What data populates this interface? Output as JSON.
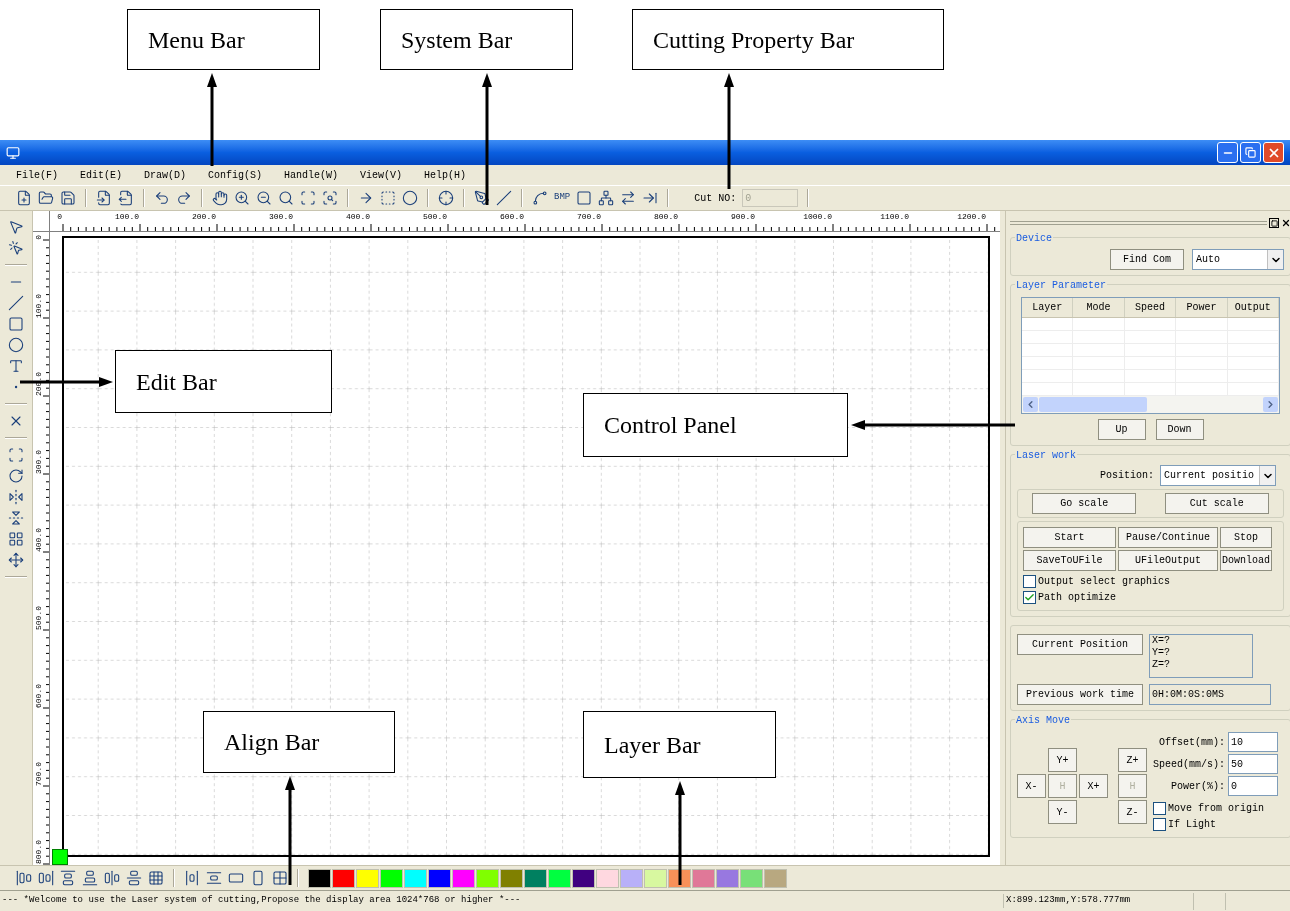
{
  "callouts": [
    {
      "label": "Menu Bar"
    },
    {
      "label": "System Bar"
    },
    {
      "label": "Cutting Property Bar"
    },
    {
      "label": "Edit Bar"
    },
    {
      "label": "Control Panel"
    },
    {
      "label": "Align Bar"
    },
    {
      "label": "Layer Bar"
    }
  ],
  "menu": [
    "File(F)",
    "Edit(E)",
    "Draw(D)",
    "Config(S)",
    "Handle(W)",
    "View(V)",
    "Help(H)"
  ],
  "toolbar": {
    "bmp_label": "BMP",
    "cut_no": {
      "label": "Cut NO:",
      "value": "0",
      "disabled": true
    }
  },
  "top_ruler": [
    "0",
    "100.0",
    "200.0",
    "300.0",
    "400.0",
    "500.0",
    "600.0",
    "700.0",
    "800.0",
    "900.0",
    "1000.0",
    "1100.0",
    "1200.0"
  ],
  "left_ruler": [
    "0",
    "100.0",
    "200.0",
    "300.0",
    "400.0",
    "500.0",
    "600.0",
    "700.0",
    "800.0"
  ],
  "panel": {
    "device": {
      "title": "Device",
      "find_button": "Find Com",
      "port": "Auto"
    },
    "layer_parameter": {
      "title": "Layer Parameter",
      "columns": [
        "Layer",
        "Mode",
        "Speed",
        "Power",
        "Output"
      ],
      "buttons": [
        "Up",
        "Down"
      ]
    },
    "laser_work": {
      "title": "Laser work",
      "position_label": "Position:",
      "position_value": "Current positio",
      "scale_buttons": [
        "Go scale",
        "Cut scale"
      ],
      "buttons": [
        "Start",
        "Pause/Continue",
        "Stop",
        "SaveToUFile",
        "UFileOutput",
        "Download"
      ],
      "options": [
        {
          "label": "Output select graphics",
          "checked": false
        },
        {
          "label": "Path optimize",
          "checked": true
        }
      ]
    },
    "position": {
      "current_button": "Current Position",
      "current_value": [
        "X=?",
        "Y=?",
        "Z=?"
      ],
      "time_button": "Previous work time",
      "time_value": "0H:0M:0S:0MS"
    },
    "axis_move": {
      "title": "Axis Move",
      "xy_pad": [
        {
          "label": "Y+",
          "disabled": false
        },
        {
          "label": "X-",
          "disabled": false
        },
        {
          "label": "H",
          "disabled": true
        },
        {
          "label": "X+",
          "disabled": false
        },
        {
          "label": "Y-",
          "disabled": false
        }
      ],
      "z_pad": [
        {
          "label": "Z+",
          "disabled": false
        },
        {
          "label": "H",
          "disabled": true
        },
        {
          "label": "Z-",
          "disabled": false
        }
      ],
      "fields": [
        {
          "label": "Offset(mm):",
          "value": "10"
        },
        {
          "label": "Speed(mm/s):",
          "value": "50"
        },
        {
          "label": "Power(%):",
          "value": "0"
        }
      ],
      "options": [
        {
          "label": "Move from origin",
          "checked": false
        },
        {
          "label": "If Light",
          "checked": false
        }
      ]
    }
  },
  "palette": [
    {
      "color": "#000000"
    },
    {
      "color": "#ff0000"
    },
    {
      "color": "#ffff00"
    },
    {
      "color": "#00ff00"
    },
    {
      "color": "#00ffff"
    },
    {
      "color": "#0000ff"
    },
    {
      "color": "#ff00ff"
    },
    {
      "color": "#80ff00"
    },
    {
      "color": "#808000"
    },
    {
      "color": "#008060"
    },
    {
      "color": "#00ff40"
    },
    {
      "color": "#400080"
    },
    {
      "color": "#ffd8e0"
    },
    {
      "color": "#b8b0f8"
    },
    {
      "color": "#d8f8a0"
    },
    {
      "color": "#f89058"
    },
    {
      "color": "#e07898"
    },
    {
      "color": "#9878e0"
    },
    {
      "color": "#78e078"
    },
    {
      "color": "#b8a880"
    }
  ],
  "status_bar": {
    "message": "--- *Welcome to use the Laser system of cutting,Propose the display area 1024*768 or higher *---",
    "coordinates": "X:899.123mm,Y:578.777mm"
  }
}
